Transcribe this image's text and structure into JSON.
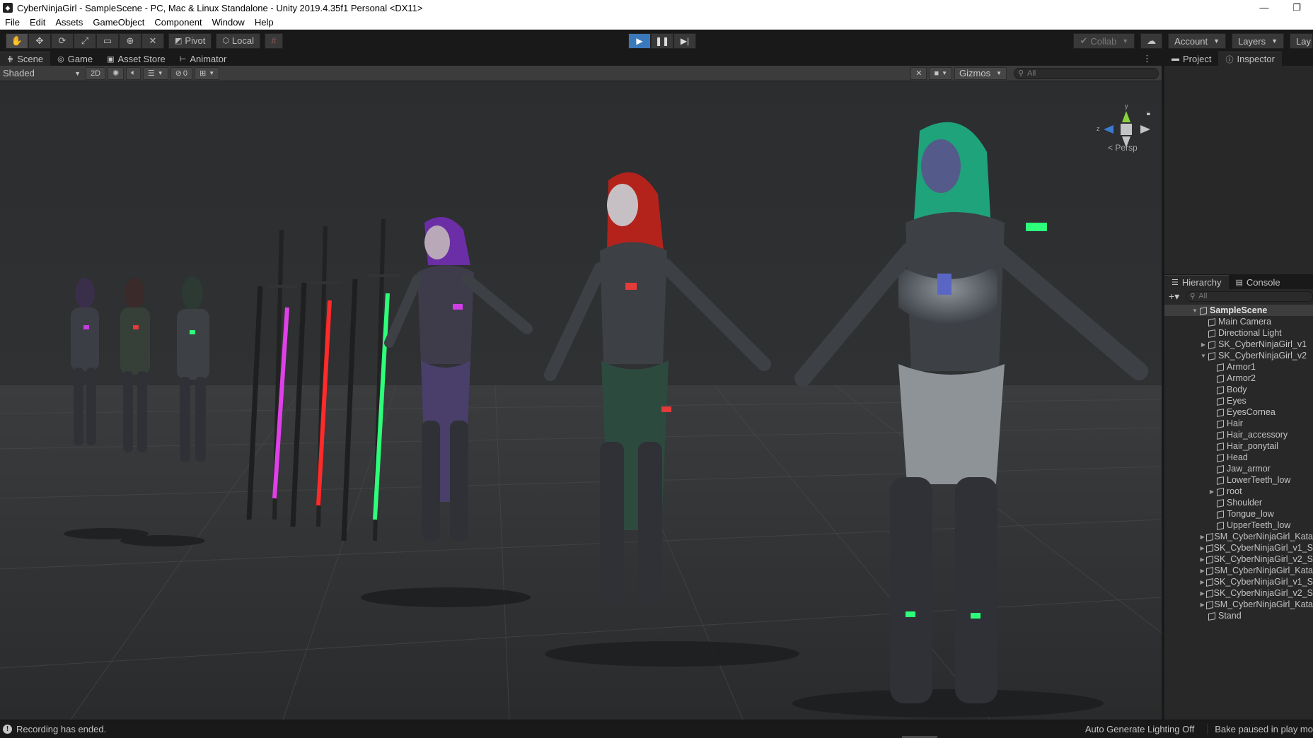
{
  "window": {
    "title": "CyberNinjaGirl - SampleScene - PC, Mac & Linux Standalone - Unity 2019.4.35f1 Personal <DX11>",
    "controls": [
      "—",
      "❐"
    ]
  },
  "menu": [
    "File",
    "Edit",
    "Assets",
    "GameObject",
    "Component",
    "Window",
    "Help"
  ],
  "toolbar": {
    "tools": [
      "hand-tool-icon",
      "move-tool-icon",
      "rotate-tool-icon",
      "scale-tool-icon",
      "rect-tool-icon",
      "transform-tool-icon",
      "custom-tool-icon"
    ],
    "pivot_label": "Pivot",
    "local_label": "Local",
    "collab_label": "Collab",
    "account_label": "Account",
    "layers_label": "Layers",
    "layout_label": "Lay"
  },
  "scene_tabs": {
    "scene": "Scene",
    "game": "Game",
    "asset_store": "Asset Store",
    "animator": "Animator"
  },
  "scene_toolbar": {
    "shading_mode": "Shaded",
    "mode_2d": "2D",
    "hidden_count": "0",
    "gizmos_label": "Gizmos",
    "search_placeholder": "All"
  },
  "viewport": {
    "projection_label": "< Persp",
    "gizmo_axes": [
      "y",
      "z"
    ]
  },
  "right_tabs": {
    "project": "Project",
    "inspector": "Inspector"
  },
  "hierarchy": {
    "tab_label": "Hierarchy",
    "console_label": "Console",
    "search_placeholder": "All",
    "items": [
      {
        "label": "SampleScene",
        "arrow": "▼"
      },
      {
        "label": "Main Camera",
        "arrow": ""
      },
      {
        "label": "Directional Light",
        "arrow": ""
      },
      {
        "label": "SK_CyberNinjaGirl_v1",
        "arrow": "▶"
      },
      {
        "label": "SK_CyberNinjaGirl_v2",
        "arrow": "▼"
      },
      {
        "label": "Armor1",
        "arrow": ""
      },
      {
        "label": "Armor2",
        "arrow": ""
      },
      {
        "label": "Body",
        "arrow": ""
      },
      {
        "label": "Eyes",
        "arrow": ""
      },
      {
        "label": "EyesCornea",
        "arrow": ""
      },
      {
        "label": "Hair",
        "arrow": ""
      },
      {
        "label": "Hair_accessory",
        "arrow": ""
      },
      {
        "label": "Hair_ponytail",
        "arrow": ""
      },
      {
        "label": "Head",
        "arrow": ""
      },
      {
        "label": "Jaw_armor",
        "arrow": ""
      },
      {
        "label": "LowerTeeth_low",
        "arrow": ""
      },
      {
        "label": "root",
        "arrow": "▶"
      },
      {
        "label": "Shoulder",
        "arrow": ""
      },
      {
        "label": "Tongue_low",
        "arrow": ""
      },
      {
        "label": "UpperTeeth_low",
        "arrow": ""
      },
      {
        "label": "SM_CyberNinjaGirl_Kata",
        "arrow": "▶"
      },
      {
        "label": "SK_CyberNinjaGirl_v1_S",
        "arrow": "▶"
      },
      {
        "label": "SK_CyberNinjaGirl_v2_S",
        "arrow": "▶"
      },
      {
        "label": "SM_CyberNinjaGirl_Kata",
        "arrow": "▶"
      },
      {
        "label": "SK_CyberNinjaGirl_v1_S",
        "arrow": "▶"
      },
      {
        "label": "SK_CyberNinjaGirl_v2_S",
        "arrow": "▶"
      },
      {
        "label": "SM_CyberNinjaGirl_Kata",
        "arrow": "▶"
      },
      {
        "label": "Stand",
        "arrow": ""
      }
    ]
  },
  "status": {
    "message": "Recording has ended.",
    "lighting": "Auto Generate Lighting Off",
    "bake": "Bake paused in play mo"
  },
  "colors": {
    "play_active": "#3a79bb",
    "hair_green": "#1fa37a",
    "hair_red": "#b3231c",
    "hair_purple": "#6b2ea6",
    "blade_pink": "#e040e8",
    "blade_red": "#ff2a2a",
    "blade_green": "#2dff7a"
  }
}
